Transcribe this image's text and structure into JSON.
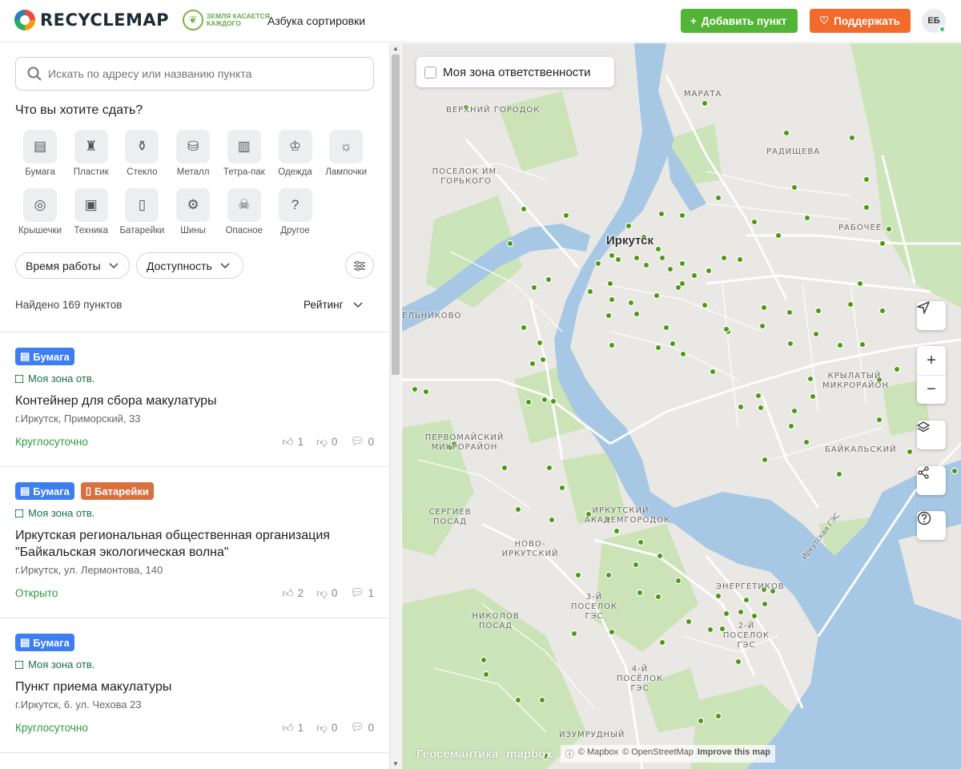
{
  "header": {
    "logo_text": "RECYCLEMAP",
    "partner_text": "ЗЕМЛЯ КАСАЕТСЯ КАЖДОГО",
    "nav_link": "Азбука сортировки",
    "add_button": "Добавить пункт",
    "support_button": "Поддержать",
    "avatar_initials": "ЕБ",
    "colors": {
      "add": "#52b535",
      "support": "#f26b2b"
    }
  },
  "sidebar": {
    "search_placeholder": "Искать по адресу или названию пункта",
    "section_title": "Что вы хотите сдать?",
    "categories": [
      {
        "label": "Бумага",
        "icon": "paper-icon"
      },
      {
        "label": "Пластик",
        "icon": "plastic-bottle-icon"
      },
      {
        "label": "Стекло",
        "icon": "glass-bottle-icon"
      },
      {
        "label": "Металл",
        "icon": "metal-can-icon"
      },
      {
        "label": "Тетра-пак",
        "icon": "tetra-pak-icon"
      },
      {
        "label": "Одежда",
        "icon": "clothes-icon"
      },
      {
        "label": "Лампочки",
        "icon": "lamp-icon"
      },
      {
        "label": "Крышечки",
        "icon": "bottle-cap-icon"
      },
      {
        "label": "Техника",
        "icon": "appliance-icon"
      },
      {
        "label": "Батарейки",
        "icon": "battery-icon"
      },
      {
        "label": "Шины",
        "icon": "tire-icon"
      },
      {
        "label": "Опасное",
        "icon": "hazard-icon"
      },
      {
        "label": "Другое",
        "icon": "question-icon"
      }
    ],
    "filters": {
      "time": "Время работы",
      "access": "Доступность"
    },
    "found_text": "Найдено 169 пунктов",
    "sort_label": "Рейтинг",
    "cards": [
      {
        "tags": [
          {
            "label": "Бумага",
            "type": "paper"
          }
        ],
        "zone": "Моя зона отв.",
        "title": "Контейнер для сбора макулатуры",
        "address": "г.Иркутск, Приморский, 33",
        "status": "Круглосуточно",
        "likes": "1",
        "dislikes": "0",
        "comments": "0"
      },
      {
        "tags": [
          {
            "label": "Бумага",
            "type": "paper"
          },
          {
            "label": "Батарейки",
            "type": "battery"
          }
        ],
        "zone": "Моя зона отв.",
        "title": "Иркутская региональная общественная организация \"Байкальская экологическая волна\"",
        "address": "г.Иркутск, ул. Лермонтова, 140",
        "status": "Открыто",
        "likes": "2",
        "dislikes": "0",
        "comments": "1"
      },
      {
        "tags": [
          {
            "label": "Бумага",
            "type": "paper"
          }
        ],
        "zone": "Моя зона отв.",
        "title": "Пункт приема макулатуры",
        "address": "г.Иркутск, 6. ул. Чехова 23",
        "status": "Круглосуточно",
        "likes": "1",
        "dislikes": "0",
        "comments": "0"
      }
    ]
  },
  "map": {
    "zone_toggle_label": "Моя зона ответственности",
    "city_label": "Иркутск",
    "district_labels": [
      "ВЕРХНИЙ ГОРОДОК",
      "ПОСЕЛОК ИМ. ГОРЬКОГО",
      "МАРАТА",
      "РАДИЩЕВА",
      "РАБОЧЕЕ",
      "ЕЛЬНИКОВО",
      "КРЫЛАТЫЙ МИКРОРАЙОН",
      "БАЙКАЛЬСКИЙ",
      "ПЕРВОМАЙСКИЙ МИКРОРАЙОН",
      "СЕРГИЕВ ПОСАД",
      "ИРКУТСКИЙ АКАДЕМГОРОДОК",
      "НОВО-ИРКУТСКИЙ",
      "3-Й ПОСЕЛОК ГЭС",
      "ЭНЕРГЕТИКОВ",
      "2-Й ПОСЕЛОК ГЭС",
      "НИКОЛОВ ПОСАД",
      "4-Й ПОСЁЛОК ГЭС",
      "ИЗУМРУДНЫЙ",
      "Иркутская ГЭС"
    ],
    "attribution_logo_1": "Геосемантика",
    "attribution_logo_2": "mapbox",
    "attribution": [
      "© Mapbox",
      "© OpenStreetMap",
      "Improve this map"
    ],
    "point_color": "#4c9a12"
  }
}
